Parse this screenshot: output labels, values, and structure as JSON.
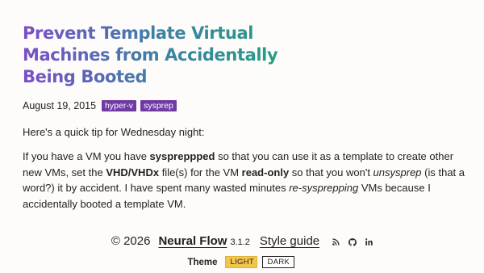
{
  "post": {
    "title": "Prevent Template Virtual Machines from Accidentally Being Booted",
    "date": "August 19, 2015",
    "tags": [
      "hyper-v",
      "sysprep"
    ],
    "intro": "Here's a quick tip for Wednesday night:",
    "body": {
      "t1": "If you have a VM you have ",
      "b1": "syspreppped",
      "t2": " so that you can use it as a template to create other new VMs, set the ",
      "b2": "VHD/VHDx",
      "t3": " file(s) for the VM ",
      "b3": "read-only",
      "t4": " so that you won't ",
      "i1": "unsysprep",
      "t5": " (is that a word?) it by accident. I have spent many wasted minutes ",
      "i2": "re-sysprepping",
      "t6": " VMs because I accidentally booted a template VM."
    }
  },
  "footer": {
    "copyright": "© 2026",
    "brand": "Neural Flow",
    "version": "3.1.2",
    "style_guide": "Style guide",
    "icons": [
      "rss-icon",
      "github-icon",
      "linkedin-icon"
    ]
  },
  "theme": {
    "label": "Theme",
    "light": "LIGHT",
    "dark": "DARK",
    "selected": "LIGHT",
    "active_color": "#f3c64a"
  },
  "colors": {
    "title_gradient_start": "#7b4ec7",
    "title_gradient_end": "#21a47c",
    "tag_bg": "#6f3aa3"
  }
}
